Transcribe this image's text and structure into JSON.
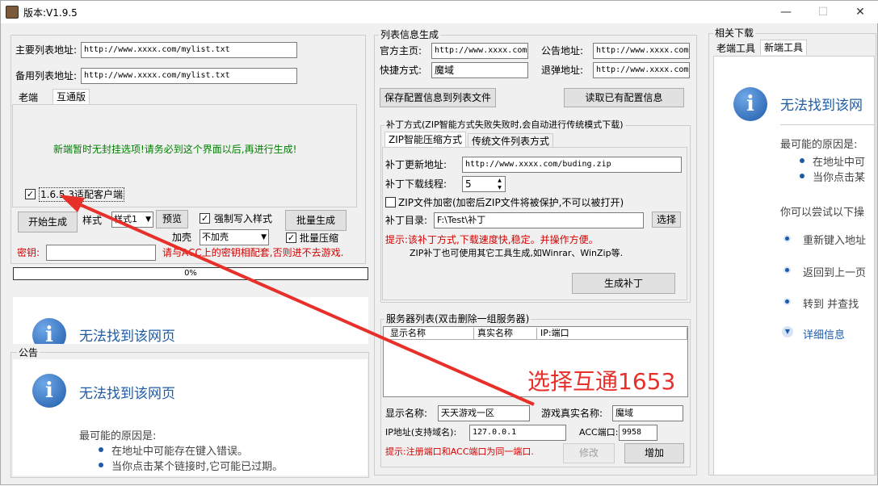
{
  "window": {
    "title": "版本:V1.9.5",
    "minimize": "—",
    "maximize": "☐",
    "close": "✕"
  },
  "left": {
    "main_list_label": "主要列表地址:",
    "main_list_value": "http://www.xxxx.com/mylist.txt",
    "backup_list_label": "备用列表地址:",
    "backup_list_value": "http://www.xxxx.com/mylist.txt",
    "tabs": [
      "老端",
      "互通版"
    ],
    "notice_green": "新端暂时无封挂选项!请务必到这个界面以后,再进行生成!",
    "adapt_checkbox": "1.6.5.3适配客户端",
    "start_button": "开始生成",
    "style_label": "样式",
    "style_value": "样式1",
    "preview_button": "预览",
    "force_style_checkbox": "强制写入样式",
    "batch_button": "批量生成",
    "shell_label": "加壳",
    "shell_value": "不加壳",
    "batch_compress_checkbox": "批量压缩",
    "key_label": "密钥:",
    "key_hint": "请与ACC上的密钥相配套,否则进不去游戏.",
    "progress": "0%",
    "ie_title": "无法找到该网页",
    "notice_group": "公告",
    "ie2_title": "无法找到该网页",
    "ie2_reason": "最可能的原因是:",
    "ie2_items": [
      "在地址中可能存在键入错误。",
      "当你点击某个链接时,它可能已过期。"
    ]
  },
  "middle": {
    "group_title": "列表信息生成",
    "home_label": "官方主页:",
    "home_value": "http://www.xxxx.com",
    "notice_label": "公告地址:",
    "notice_value": "http://www.xxxx.com",
    "shortcut_label": "快捷方式:",
    "shortcut_value": "魔域",
    "bounce_label": "退弹地址:",
    "bounce_value": "http://www.xxxx.com",
    "save_button": "保存配置信息到列表文件",
    "read_button": "读取已有配置信息",
    "patch_group": "补丁方式(ZIP智能方式失败失败时,会自动进行传统模式下载)",
    "patch_tabs": [
      "ZIP智能压缩方式",
      "传统文件列表方式"
    ],
    "patch_url_label": "补丁更新地址:",
    "patch_url_value": "http://www.xxxx.com/buding.zip",
    "threads_label": "补丁下载线程:",
    "threads_value": "5",
    "zip_encrypt": "ZIP文件加密(加密后ZIP文件将被保护,不可以被打开)",
    "dir_label": "补丁目录:",
    "dir_value": "F:\\Test\\补丁",
    "browse_button": "选择",
    "tip_red": "提示:该补丁方式,下载速度快,稳定。并操作方便。",
    "tip_black": "ZIP补丁也可使用其它工具生成,如Winrar、WinZip等.",
    "gen_patch_button": "生成补丁",
    "server_group": "服务器列表(双击删除一组服务器)",
    "columns": [
      "显示名称",
      "真实名称",
      "IP:端口"
    ],
    "display_label": "显示名称:",
    "display_value": "天天游戏一区",
    "real_label": "游戏真实名称:",
    "real_value": "魔域",
    "ip_label": "IP地址(支持域名):",
    "ip_value": "127.0.0.1",
    "acc_label": "ACC端口:",
    "acc_value": "9958",
    "tip_port": "提示:注册端口和ACC端口为同一端口.",
    "modify_button": "修改",
    "add_button": "增加"
  },
  "right": {
    "group_title": "相关下载",
    "tabs": [
      "老端工具",
      "新端工具"
    ],
    "ie_title": "无法找到该网",
    "reason": "最可能的原因是:",
    "items": [
      "在地址中可",
      "当你点击某"
    ],
    "try_text": "你可以尝试以下操",
    "actions": [
      "重新键入地址",
      "返回到上一页",
      "转到  并查找"
    ],
    "details": "详细信息"
  },
  "annotation": {
    "text": "选择互通1653",
    "color": "#e8302a"
  },
  "colors": {
    "ie_blue": "#1f5ca8",
    "tip_red": "#d40000",
    "notice_green": "#008000"
  },
  "icons": [
    "app-icon",
    "info-icon",
    "checkbox-check-icon",
    "dropdown-arrow-icon",
    "spin-up-icon",
    "spin-down-icon",
    "red-arrow-icon"
  ]
}
